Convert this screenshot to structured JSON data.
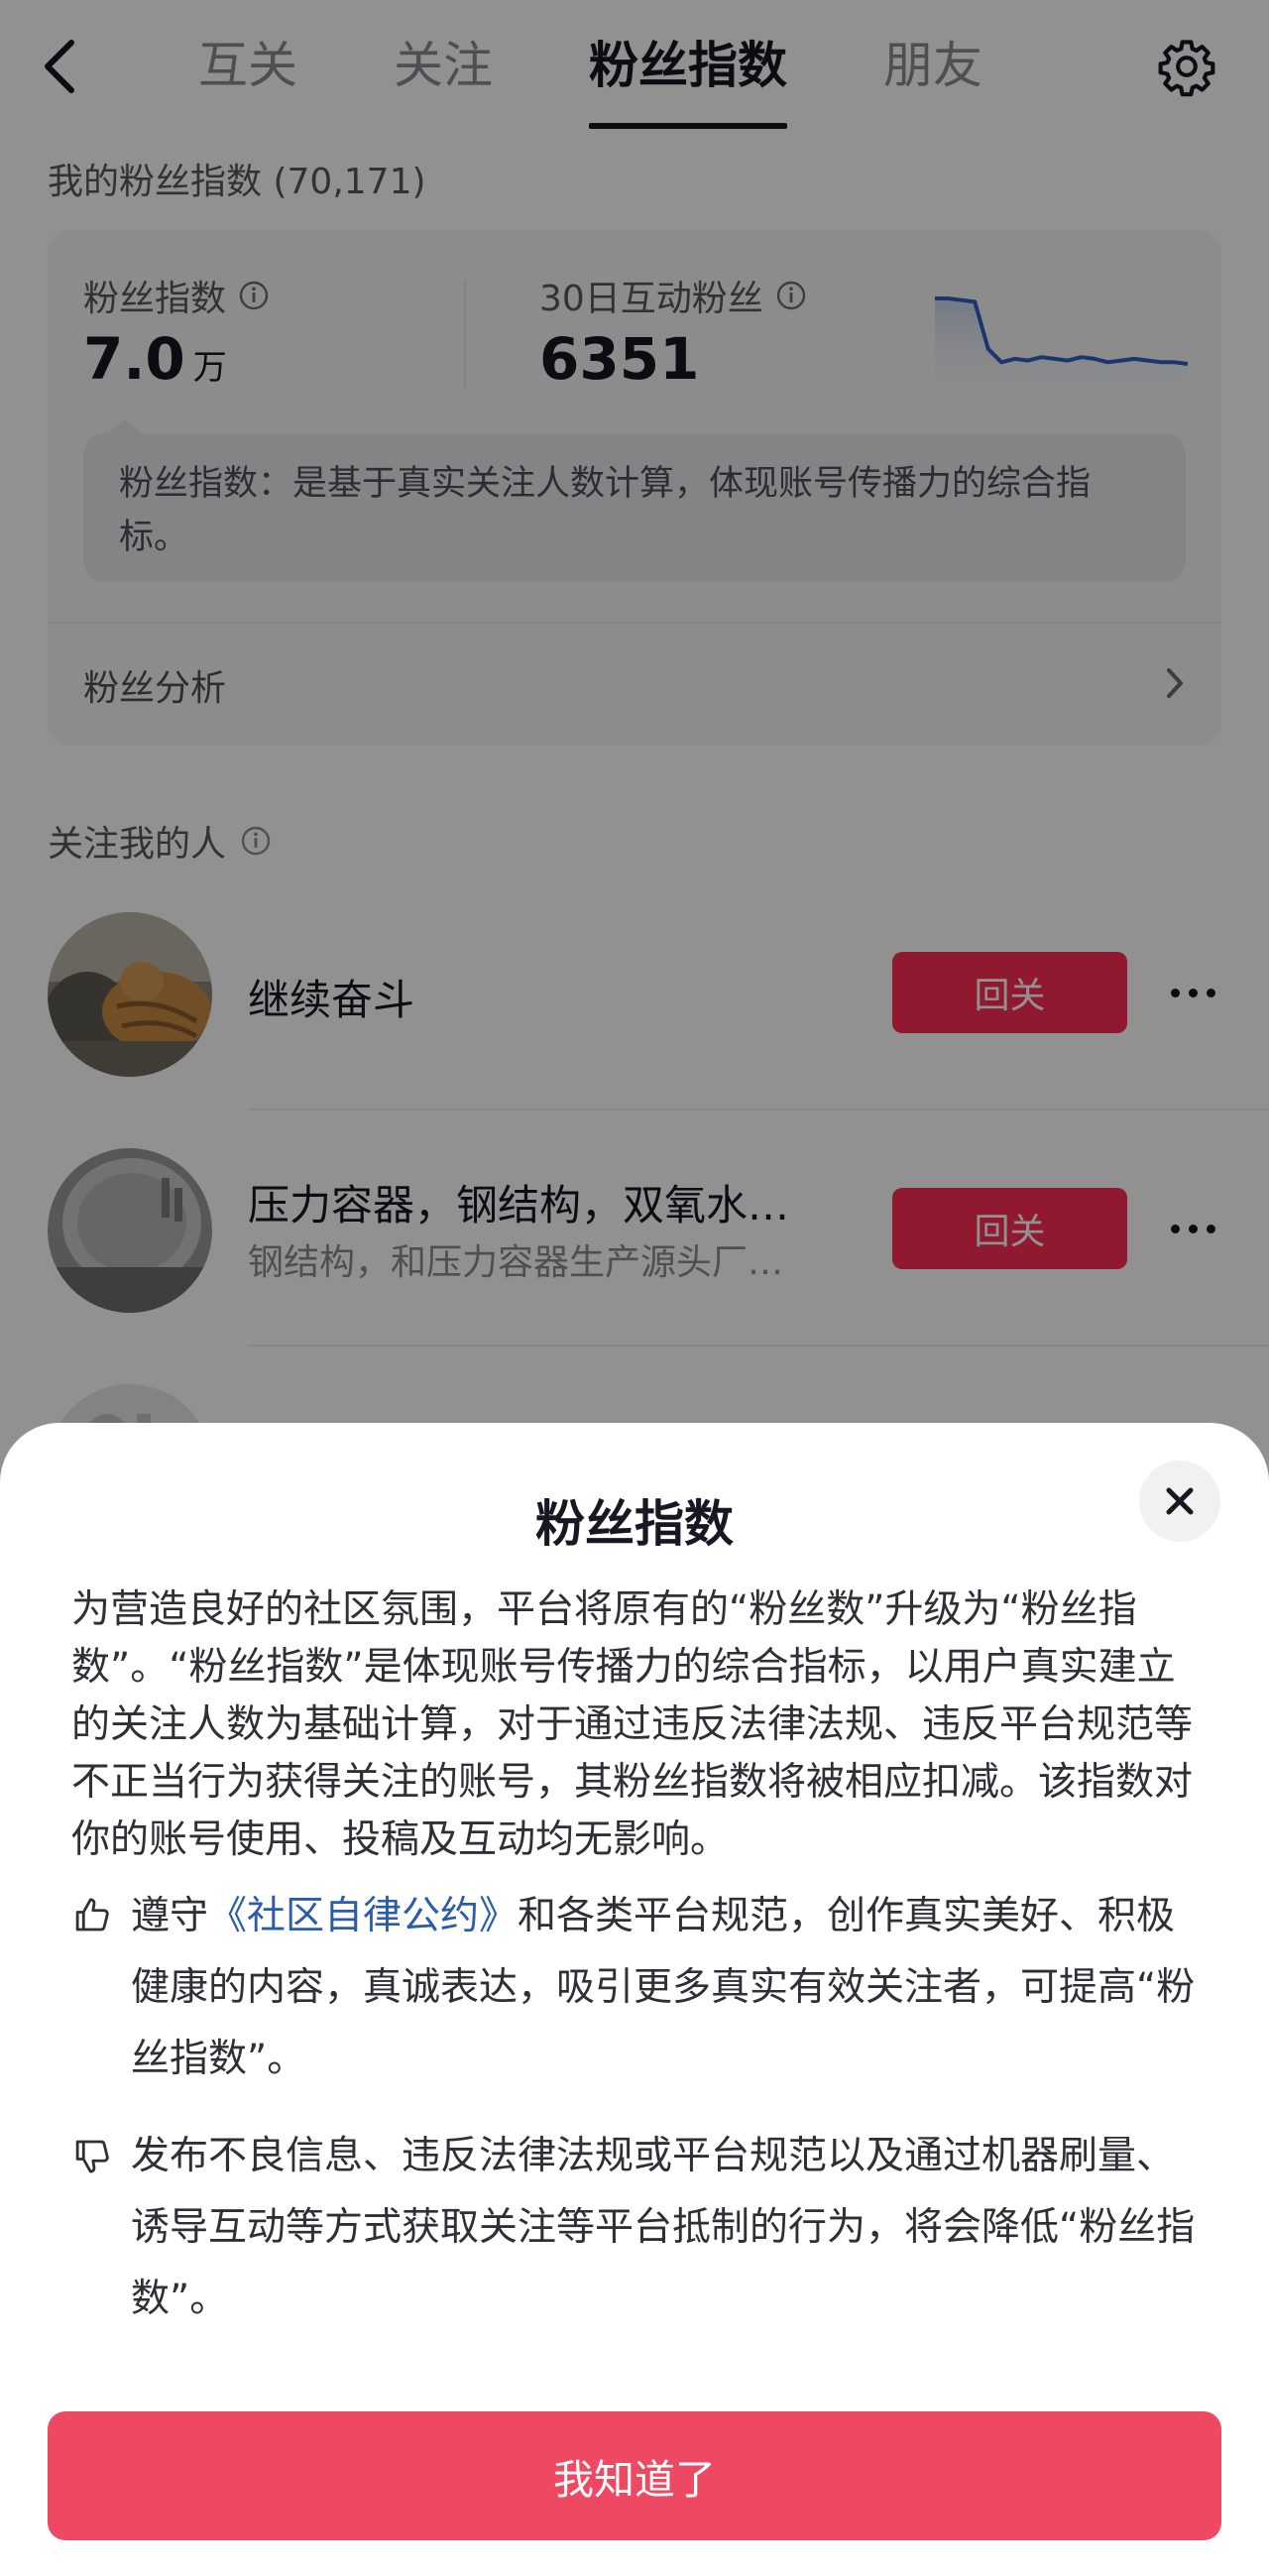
{
  "header": {
    "tabs": [
      {
        "label": "互关",
        "active": false
      },
      {
        "label": "关注",
        "active": false
      },
      {
        "label": "粉丝指数",
        "active": true
      },
      {
        "label": "朋友",
        "active": false
      }
    ]
  },
  "fan_index": {
    "section_title": "我的粉丝指数",
    "section_count": "(70,171)",
    "metric1_label": "粉丝指数",
    "metric1_value": "7.0",
    "metric1_unit": "万",
    "metric2_label": "30日互动粉丝",
    "metric2_value": "6351",
    "tooltip": "粉丝指数：是基于真实关注人数计算，体现账号传播力的综合指标。",
    "analysis_label": "粉丝分析"
  },
  "followers": {
    "section_title": "关注我的人",
    "items": [
      {
        "name": "继续奋斗",
        "subtitle": "",
        "button": "回关"
      },
      {
        "name": "压力容器，钢结构，双氧水…",
        "subtitle": "钢结构，和压力容器生产源头厂…",
        "button": "回关"
      }
    ]
  },
  "sheet": {
    "title": "粉丝指数",
    "body": "为营造良好的社区氛围，平台将原有的“粉丝数”升级为“粉丝指数”。“粉丝指数”是体现账号传播力的综合指标，以用户真实建立的关注人数为基础计算，对于通过违反法律法规、违反平台规范等不正当行为获得关注的账号，其粉丝指数将被相应扣减。该指数对你的账号使用、投稿及互动均无影响。",
    "tip_up_prefix": "遵守",
    "tip_up_link": "《社区自律公约》",
    "tip_up_suffix": "和各类平台规范，创作真实美好、积极健康的内容，真诚表达，吸引更多真实有效关注者，可提高“粉丝指数”。",
    "tip_down": "发布不良信息、违反法律法规或平台规范以及通过机器刷量、诱导互动等方式获取关注等平台抵制的行为，将会降低“粉丝指数”。",
    "confirm_label": "我知道了"
  },
  "colors": {
    "accent": "#fe2c55",
    "confirm": "#ee4862",
    "link": "#2a5ca8",
    "sparkline": "#2f5fc4"
  },
  "sparkline": {
    "values": [
      100,
      100,
      99,
      98,
      70,
      62,
      64,
      63,
      65,
      64,
      63,
      65,
      64,
      62,
      63,
      64,
      63,
      62,
      62,
      61
    ]
  }
}
